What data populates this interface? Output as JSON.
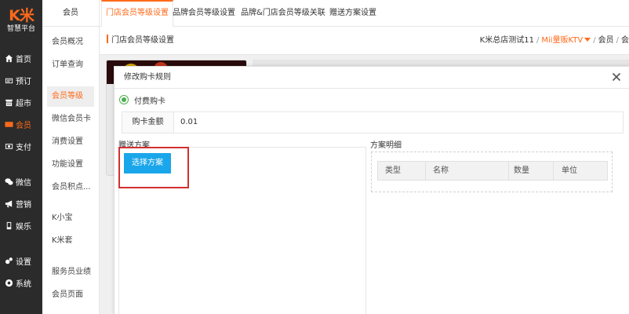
{
  "app": {
    "logo_text": "K米",
    "logo_sub": "智慧平台"
  },
  "nav": {
    "items": [
      {
        "label": "首页",
        "icon": "home-icon"
      },
      {
        "label": "预订",
        "icon": "booking-icon"
      },
      {
        "label": "超市",
        "icon": "shop-icon"
      },
      {
        "label": "会员",
        "icon": "member-card-icon",
        "active": true
      },
      {
        "label": "支付",
        "icon": "payment-icon"
      },
      {
        "label": "微信",
        "icon": "wechat-icon"
      },
      {
        "label": "营销",
        "icon": "megaphone-icon"
      },
      {
        "label": "娱乐",
        "icon": "entertainment-icon"
      },
      {
        "label": "设置",
        "icon": "settings-icon"
      },
      {
        "label": "系统",
        "icon": "system-icon"
      }
    ]
  },
  "submenu": {
    "title": "会员",
    "items": [
      {
        "label": "会员概况"
      },
      {
        "label": "订单查询"
      },
      {
        "label": "会员等级",
        "active": true
      },
      {
        "label": "微信会员卡"
      },
      {
        "label": "消费设置"
      },
      {
        "label": "功能设置"
      },
      {
        "label": "会员积点..."
      },
      {
        "label": "K小宝"
      },
      {
        "label": "K米套"
      },
      {
        "label": "服务员业绩"
      },
      {
        "label": "会员页面"
      }
    ]
  },
  "tabs": [
    {
      "label": "门店会员等级设置",
      "active": true
    },
    {
      "label": "品牌会员等级设置"
    },
    {
      "label": "品牌&门店会员等级关联"
    },
    {
      "label": "赠送方案设置"
    }
  ],
  "breadcrumb": {
    "current": "门店会员等级设置",
    "store": "K米总店测试11",
    "venue": "Mii量贩KTV",
    "level1": "会员",
    "level2": "会"
  },
  "modal": {
    "title": "修改购卡规则",
    "radio_label": "付费购卡",
    "amount_label": "购卡金额",
    "amount_value": "0.01",
    "gift_label": "赠送方案",
    "plan_label": "方案明细",
    "select_button": "选择方案",
    "table_headers": [
      "类型",
      "名称",
      "数量",
      "单位"
    ]
  },
  "colors": {
    "accent": "#ff6a1a",
    "sidebar_bg": "#2b2b2b",
    "button_blue": "#1aa6ea",
    "highlight_red": "#d32f2f",
    "radio_green": "#4caf50"
  }
}
